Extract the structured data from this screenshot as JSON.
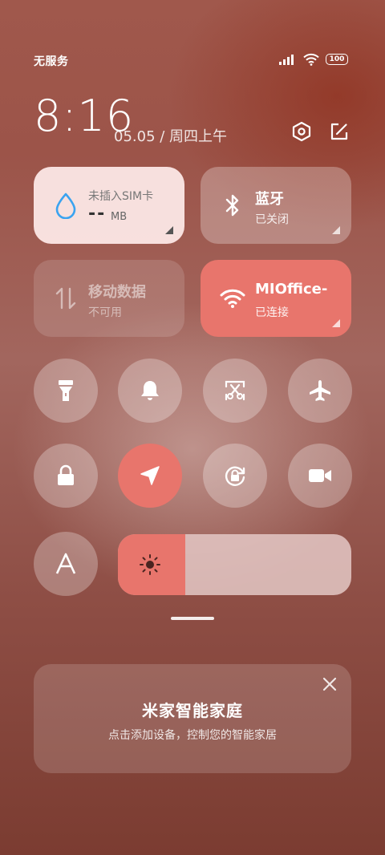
{
  "status_bar": {
    "carrier": "无服务",
    "battery": "100"
  },
  "header": {
    "time": "8:16",
    "date": "05.05 / 周四上午"
  },
  "tiles": {
    "data_usage": {
      "title": "未插入SIM卡",
      "value": "--",
      "unit": "MB"
    },
    "bluetooth": {
      "title": "蓝牙",
      "status": "已关闭"
    },
    "mobile_data": {
      "title": "移动数据",
      "status": "不可用"
    },
    "wifi": {
      "title": "MIOffice-",
      "status": "已连接"
    }
  },
  "brightness": {
    "level": 0.29
  },
  "smart_home": {
    "title": "米家智能家庭",
    "subtitle": "点击添加设备，控制您的智能家居"
  },
  "colors": {
    "accent": "#e8756c",
    "water": "#3aa3f0"
  }
}
